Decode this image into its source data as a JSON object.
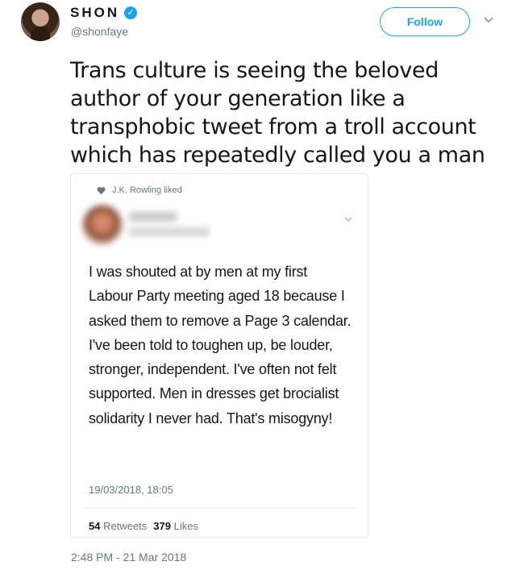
{
  "author": {
    "display_name": "SHON",
    "handle": "@shonfaye",
    "verified_mark": "✓"
  },
  "follow_label": "Follow",
  "tweet_text": "Trans culture is seeing the beloved author of your generation like a transphobic tweet from a troll account which has repeatedly called you a man",
  "embedded": {
    "liked_by": "J.K. Rowling liked",
    "text": "I was shouted at by men at my first Labour Party meeting aged 18 because I asked them to remove a Page 3 calendar. I've been told to toughen up, be louder, stronger, independent. I've often not felt supported. Men in dresses get brocialist solidarity I never had. That's misogyny!",
    "timestamp": "19/03/2018, 18:05",
    "retweets_count": "54",
    "retweets_label": "Retweets",
    "likes_count": "379",
    "likes_label": "Likes"
  },
  "timestamp": "2:48 PM - 21 Mar 2018",
  "colors": {
    "accent": "#1da1f2",
    "muted": "#657786",
    "text": "#14171a"
  },
  "icons": [
    "verified-icon",
    "chevron-down-icon",
    "heart-icon"
  ]
}
